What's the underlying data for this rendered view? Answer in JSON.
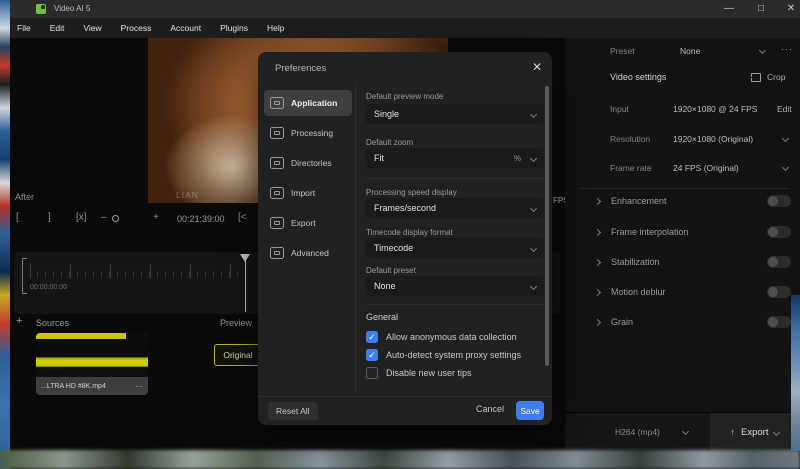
{
  "titlebar": {
    "title": "Video AI 5"
  },
  "menubar": {
    "items": [
      "File",
      "Edit",
      "View",
      "Process",
      "Account",
      "Plugins",
      "Help"
    ]
  },
  "icons": {
    "minimize": "—",
    "maximize": "□",
    "close": "✕",
    "check": "✓",
    "ellipsis": "···",
    "plus": "+",
    "minus": "–",
    "up_arrow": "↑"
  },
  "preview": {
    "after_label": "After",
    "watermark": "LIAN",
    "fps_fragment": "FPS"
  },
  "transport": {
    "in_bracket": "[",
    "out_bracket": "]",
    "clear_marks": "[x]",
    "zoom_out": "–",
    "zoom_in": "+",
    "timecode": "00:21:39:00",
    "prev_frame": "[<"
  },
  "timeline": {
    "start_timecode": "00:00:00:00"
  },
  "sources": {
    "add": "+",
    "title": "Sources",
    "clip_name": "...LTRA HD #8K.mp4",
    "clip_menu": "···",
    "preview_label": "Preview",
    "original_label": "Original"
  },
  "right_panel": {
    "preset_label": "Preset",
    "preset_value": "None",
    "video_settings_label": "Video settings",
    "crop_label": "Crop",
    "input_label": "Input",
    "input_value": "1920×1080 @ 24 FPS",
    "input_action": "Edit",
    "resolution_label": "Resolution",
    "resolution_value": "1920×1080 (Original)",
    "framerate_label": "Frame rate",
    "framerate_value": "24 FPS (Original)",
    "toggles": [
      {
        "label": "Enhancement",
        "on": false
      },
      {
        "label": "Frame interpolation",
        "on": false
      },
      {
        "label": "Stabilization",
        "on": false
      },
      {
        "label": "Motion deblur",
        "on": false
      },
      {
        "label": "Grain",
        "on": false
      }
    ],
    "export_format": "H264 (mp4)",
    "export_label": "Export"
  },
  "dialog": {
    "title": "Preferences",
    "sidebar": [
      {
        "label": "Application",
        "selected": true
      },
      {
        "label": "Processing",
        "selected": false
      },
      {
        "label": "Directories",
        "selected": false
      },
      {
        "label": "Import",
        "selected": false
      },
      {
        "label": "Export",
        "selected": false
      },
      {
        "label": "Advanced",
        "selected": false
      }
    ],
    "fields": [
      {
        "label": "Default preview mode",
        "value": "Single"
      },
      {
        "label": "Default zoom",
        "value": "Fit",
        "suffix": "%"
      },
      {
        "label": "Processing speed display",
        "value": "Frames/second"
      },
      {
        "label": "Timecode display format",
        "value": "Timecode"
      },
      {
        "label": "Default preset",
        "value": "None"
      }
    ],
    "general_heading": "General",
    "checkboxes": [
      {
        "label": "Allow anonymous data collection",
        "checked": true
      },
      {
        "label": "Auto-detect system proxy settings",
        "checked": true
      },
      {
        "label": "Disable new user tips",
        "checked": false
      }
    ],
    "reset_label": "Reset All",
    "cancel_label": "Cancel",
    "save_label": "Save"
  },
  "colors": {
    "accent_blue": "#3d7dee",
    "logo_green": "#74c13e",
    "original_yellow": "#b5b51e"
  }
}
